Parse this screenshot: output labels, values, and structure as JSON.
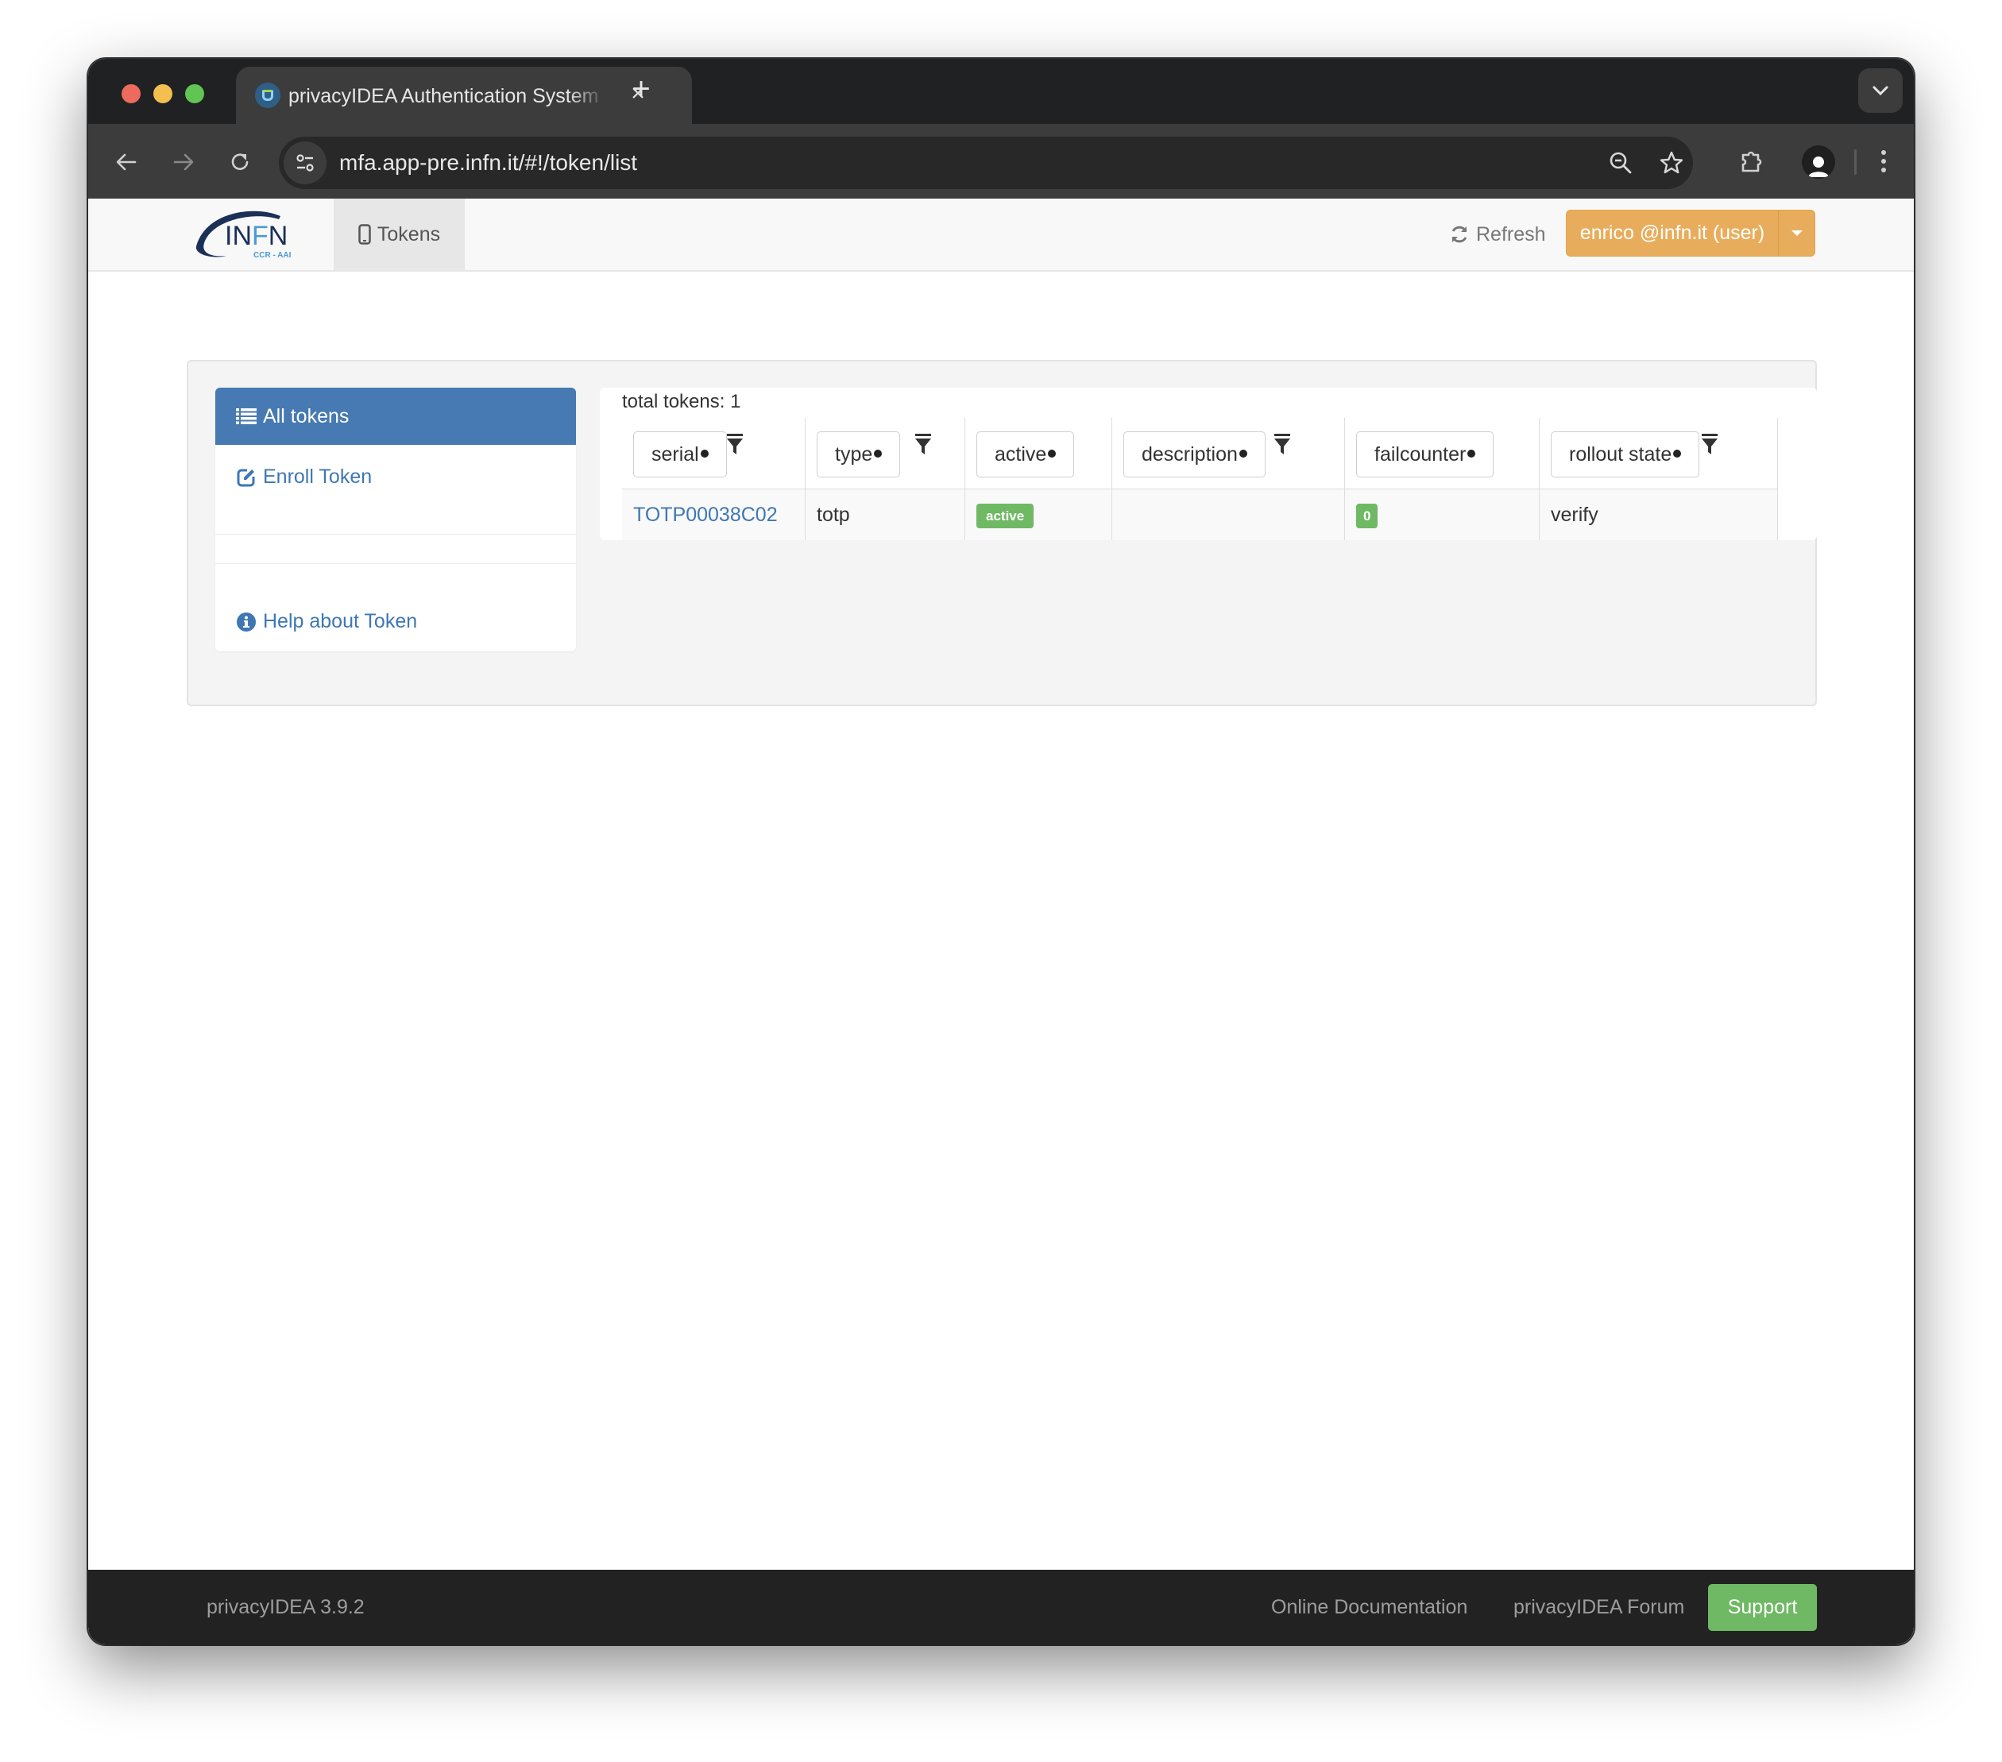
{
  "browser": {
    "tab_title": "privacyIDEA Authentication System",
    "url": "mfa.app-pre.infn.it/#!/token/list",
    "icons": {
      "back": "arrow-left-icon",
      "forward": "arrow-right-icon",
      "reload": "reload-icon",
      "site_info": "tune-icon",
      "zoom": "zoom-out-icon",
      "bookmark": "star-icon",
      "extensions": "puzzle-icon",
      "profile": "person-icon",
      "menu": "kebab-icon",
      "tab_search": "chevron-down-icon"
    }
  },
  "navbar": {
    "brand": {
      "main": "INFN",
      "sub": "CCR - AAI"
    },
    "tokens_label": "Tokens",
    "refresh_label": "Refresh",
    "user_label": "enrico @infn.it (user)"
  },
  "sidebar": {
    "items": [
      {
        "label": "All tokens",
        "icon": "list-icon",
        "active": true
      },
      {
        "label": "Enroll Token",
        "icon": "edit-icon",
        "active": false
      },
      {
        "label": "Help about Token",
        "icon": "info-circle-icon",
        "active": false
      }
    ]
  },
  "tokens": {
    "total_label": "total tokens: 1",
    "columns": [
      {
        "label": "serial",
        "filter": true
      },
      {
        "label": "type",
        "filter": true
      },
      {
        "label": "active",
        "filter": false
      },
      {
        "label": "description",
        "filter": true
      },
      {
        "label": "failcounter",
        "filter": false
      },
      {
        "label": "rollout state",
        "filter": true
      }
    ],
    "rows": [
      {
        "serial": "TOTP00038C02",
        "type": "totp",
        "active": "active",
        "description": "",
        "failcounter": "0",
        "rollout_state": "verify"
      }
    ]
  },
  "footer": {
    "version": "privacyIDEA 3.9.2",
    "links": [
      "Online Documentation",
      "privacyIDEA Forum"
    ],
    "support_label": "Support"
  },
  "colors": {
    "primary": "#4779b2",
    "link": "#3e77b4",
    "warning": "#e8ad5c",
    "success": "#6fb864",
    "footer_bg": "#222222"
  }
}
